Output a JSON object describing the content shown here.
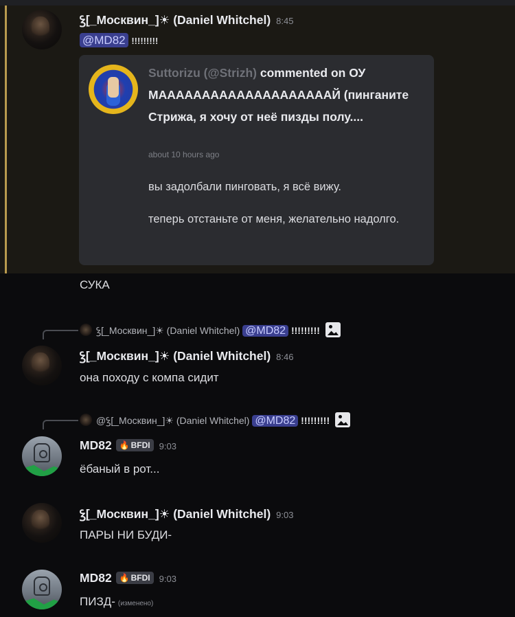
{
  "author_whitchel": "ꝣ[_Москвин_]☀ (Daniel Whitchel)",
  "author_md82": "MD82",
  "md82_tag": "BFDI",
  "messages": {
    "m1": {
      "time": "8:45",
      "mention": "@MD82",
      "text": "!!!!!!!!!",
      "embed": {
        "user": "Suttorizu (@Strizh)",
        "action": " commented on ОУ МААААААААААААААААААААЙ (пинганите Стрижа, я хочу от неё пизды полу....",
        "ago": "about 10 hours ago",
        "line1": "вы задолбали пинговать, я всё вижу.",
        "line2": "теперь отстаньте от меня, желательно надолго."
      },
      "follow": "СУКА"
    },
    "m2": {
      "reply_author": "ꝣ[_Москвин_]☀ (Daniel Whitchel)",
      "reply_mention": "@MD82",
      "reply_text": "!!!!!!!!!",
      "time": "8:46",
      "text": "она походу с компа сидит"
    },
    "m3": {
      "reply_author": "@ꝣ[_Москвин_]☀ (Daniel Whitchel)",
      "reply_mention": "@MD82",
      "reply_text": "!!!!!!!!!",
      "time": "9:03",
      "text": "ёбаный в рот..."
    },
    "m4": {
      "time": "9:03",
      "text": "ПАРЫ НИ БУДИ-"
    },
    "m5": {
      "time": "9:03",
      "text": "ПИЗД-",
      "edited": "(изменено)"
    }
  }
}
